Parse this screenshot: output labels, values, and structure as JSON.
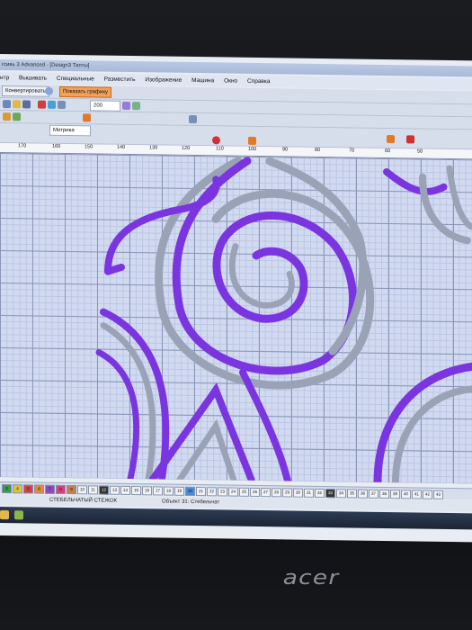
{
  "window": {
    "title": "гсивь 3 Advanced - [Design3  Тапты]"
  },
  "menu": [
    "нтр",
    "Вышивать",
    "Специальные",
    "Разместить",
    "Изображение",
    "Машина",
    "Окно",
    "Справка"
  ],
  "toolbar": {
    "convert_label": "Конвертировать",
    "show_graphics_label": "Показать графику",
    "zoom_value": "200",
    "units_label": "Метрика"
  },
  "ruler": {
    "labels": [
      "170",
      "160",
      "150",
      "140",
      "130",
      "120",
      "110",
      "100",
      "90",
      "80",
      "70",
      "60",
      "50"
    ]
  },
  "palette": {
    "swatches": [
      "3",
      "4",
      "5",
      "6",
      "7",
      "8",
      "9",
      "10",
      "11",
      "12",
      "13",
      "14",
      "15",
      "16",
      "17",
      "18",
      "19",
      "20",
      "21",
      "22",
      "23",
      "24",
      "25",
      "26",
      "27",
      "28",
      "29",
      "30",
      "31",
      "32",
      "33",
      "34",
      "35",
      "36",
      "37",
      "38",
      "39",
      "40",
      "41",
      "42",
      "43"
    ]
  },
  "status": {
    "stitch_type": "СТЕБЕЛЬЧАТЫЙ СТЕЖОК",
    "object_info": "Объект 31: Стебельчат"
  },
  "colors": {
    "stitch_purple": "#7b35e0",
    "stitch_grey": "#9aa3b6",
    "grid_bg": "#d2daf1",
    "accent_orange": "#f2a05a"
  },
  "device_logo": "acer"
}
